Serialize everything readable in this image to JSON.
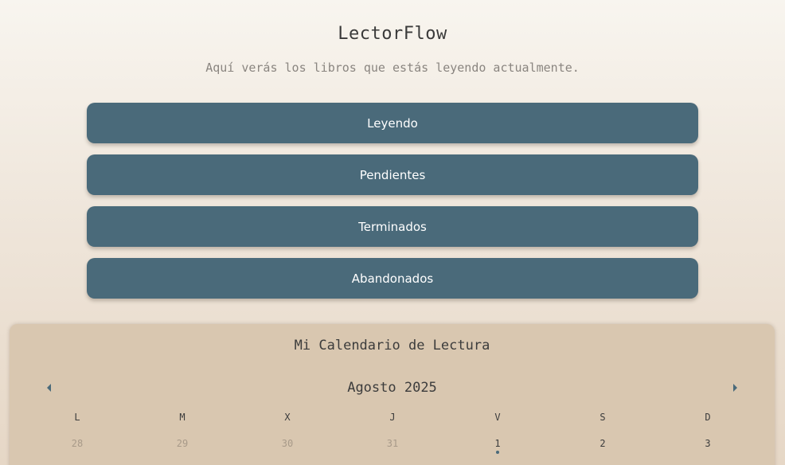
{
  "app": {
    "title": "LectorFlow",
    "subtitle": "Aquí verás los libros que estás leyendo actualmente."
  },
  "nav": {
    "items": [
      {
        "label": "Leyendo"
      },
      {
        "label": "Pendientes"
      },
      {
        "label": "Terminados"
      },
      {
        "label": "Abandonados"
      }
    ]
  },
  "calendar": {
    "title": "Mi Calendario de Lectura",
    "month_label": "Agosto 2025",
    "prev_icon": "chevron-left-icon",
    "next_icon": "chevron-right-icon",
    "weekdays": [
      "L",
      "M",
      "X",
      "J",
      "V",
      "S",
      "D"
    ],
    "days": [
      {
        "label": "28",
        "muted": true,
        "has_entry": false
      },
      {
        "label": "29",
        "muted": true,
        "has_entry": false
      },
      {
        "label": "30",
        "muted": true,
        "has_entry": false
      },
      {
        "label": "31",
        "muted": true,
        "has_entry": false
      },
      {
        "label": "1",
        "muted": false,
        "has_entry": true
      },
      {
        "label": "2",
        "muted": false,
        "has_entry": false
      },
      {
        "label": "3",
        "muted": false,
        "has_entry": false
      }
    ]
  },
  "colors": {
    "button_bg": "#4a6a7a",
    "button_text": "#ffffff",
    "calendar_bg": "#d9c7b0",
    "muted_day": "#a89a89",
    "entry_dot": "#4a6a7a"
  }
}
